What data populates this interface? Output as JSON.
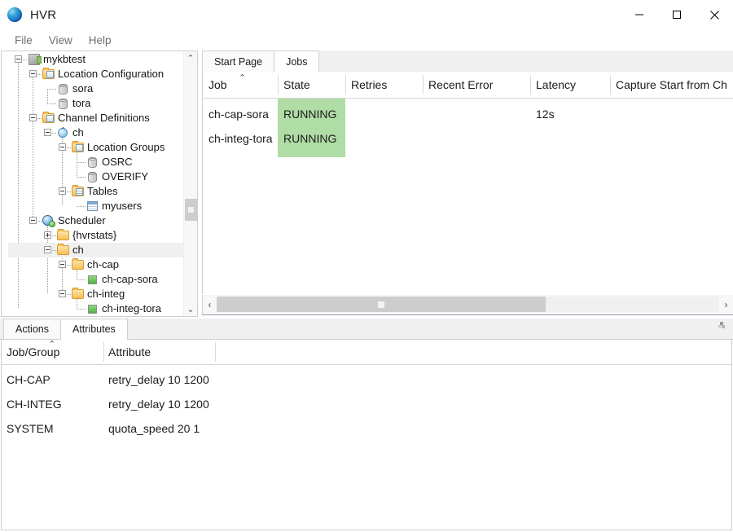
{
  "window": {
    "title": "HVR",
    "logo_icon": "hvr-sphere-logo",
    "minimize_label": "—",
    "maximize_label": "□",
    "close_label": "✕"
  },
  "menubar": {
    "items": [
      {
        "label": "File"
      },
      {
        "label": "View"
      },
      {
        "label": "Help"
      }
    ]
  },
  "tree": {
    "nodes": [
      {
        "label": "mykbtest",
        "icon": "hub-icon",
        "depth": 1,
        "expander": "minus",
        "selected": false
      },
      {
        "label": "Location Configuration",
        "icon": "folder-sheet-icon",
        "depth": 2,
        "expander": "minus",
        "selected": false
      },
      {
        "label": "sora",
        "icon": "database-icon",
        "depth": 3,
        "expander": "none",
        "selected": false
      },
      {
        "label": "tora",
        "icon": "database-icon",
        "depth": 3,
        "expander": "none",
        "selected": false
      },
      {
        "label": "Channel Definitions",
        "icon": "folder-sheet-icon",
        "depth": 2,
        "expander": "minus",
        "selected": false
      },
      {
        "label": "ch",
        "icon": "channel-icon",
        "depth": 3,
        "expander": "minus",
        "selected": false
      },
      {
        "label": "Location Groups",
        "icon": "folder-sheet-icon",
        "depth": 4,
        "expander": "minus",
        "selected": false
      },
      {
        "label": "OSRC",
        "icon": "group-icon",
        "depth": 5,
        "expander": "none",
        "selected": false
      },
      {
        "label": "OVERIFY",
        "icon": "group-icon",
        "depth": 5,
        "expander": "none",
        "selected": false
      },
      {
        "label": "Tables",
        "icon": "folder-grid-icon",
        "depth": 4,
        "expander": "minus",
        "selected": false
      },
      {
        "label": "myusers",
        "icon": "table-icon",
        "depth": 5,
        "expander": "none",
        "selected": false
      },
      {
        "label": "Scheduler",
        "icon": "scheduler-icon",
        "depth": 2,
        "expander": "minus",
        "selected": false
      },
      {
        "label": "{hvrstats}",
        "icon": "folder-icon",
        "depth": 3,
        "expander": "plus",
        "selected": false
      },
      {
        "label": "ch",
        "icon": "folder-icon",
        "depth": 3,
        "expander": "minus",
        "selected": true
      },
      {
        "label": "ch-cap",
        "icon": "folder-icon",
        "depth": 4,
        "expander": "minus",
        "selected": false
      },
      {
        "label": "ch-cap-sora",
        "icon": "job-running-icon",
        "depth": 5,
        "expander": "none",
        "selected": false
      },
      {
        "label": "ch-integ",
        "icon": "folder-icon",
        "depth": 4,
        "expander": "minus",
        "selected": false
      },
      {
        "label": "ch-integ-tora",
        "icon": "job-running-icon",
        "depth": 5,
        "expander": "none",
        "selected": false
      }
    ],
    "scrollbar": {
      "up_arrow": "⌃",
      "down_arrow": "⌄"
    }
  },
  "jobs_view": {
    "tabs": [
      {
        "label": "Start Page",
        "active": false
      },
      {
        "label": "Jobs",
        "active": true
      }
    ],
    "columns": [
      {
        "label": "Job",
        "sorted": true
      },
      {
        "label": "State",
        "sorted": false
      },
      {
        "label": "Retries",
        "sorted": false
      },
      {
        "label": "Recent Error",
        "sorted": false
      },
      {
        "label": "Latency",
        "sorted": false
      },
      {
        "label": "Capture Start from Ch",
        "sorted": false
      }
    ],
    "sort_caret": "⌃",
    "rows": [
      {
        "job": "ch-cap-sora",
        "state": "RUNNING",
        "retries": "",
        "recent_error": "",
        "latency": "12s",
        "capture_start": ""
      },
      {
        "job": "ch-integ-tora",
        "state": "RUNNING",
        "retries": "",
        "recent_error": "",
        "latency": "",
        "capture_start": ""
      }
    ],
    "state_color": "#b0dca5",
    "scrollbar": {
      "left_arrow": "‹",
      "right_arrow": "›"
    }
  },
  "bottom_panel": {
    "tabs": [
      {
        "label": "Actions",
        "active": false
      },
      {
        "label": "Attributes",
        "active": true
      }
    ],
    "columns": [
      {
        "label": "Job/Group",
        "sorted": true
      },
      {
        "label": "Attribute",
        "sorted": false
      }
    ],
    "sort_caret": "⌃",
    "rows": [
      {
        "job_group": "CH-CAP",
        "attribute": "retry_delay 10 1200"
      },
      {
        "job_group": "CH-INTEG",
        "attribute": "retry_delay 10 1200"
      },
      {
        "job_group": "SYSTEM",
        "attribute": "quota_speed 20 1"
      }
    ],
    "resize_grip_icon": "resize-grip-icon"
  }
}
